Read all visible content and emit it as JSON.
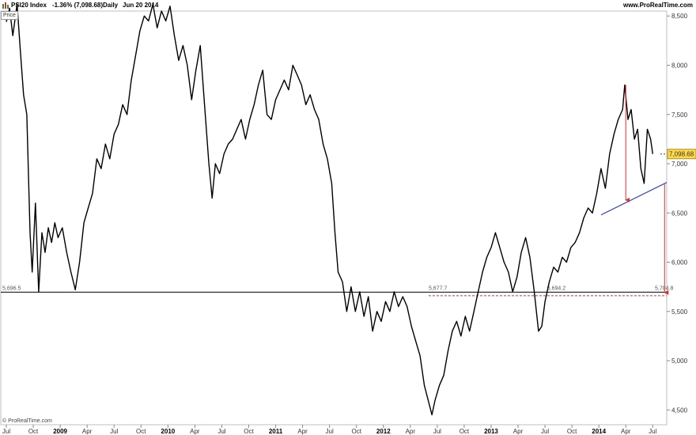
{
  "header": {
    "symbol": "PSI20 Index",
    "change": "-1.36% (7,098.68)",
    "interval": "Daily",
    "date": "Jun 20 2014",
    "site": "www.ProRealTime.com"
  },
  "price_tag": "Price",
  "copyright": "© ProRealTime.com",
  "colors": {
    "trendline": "#3344cc",
    "arrow": "#e03030",
    "price_label_bg": "#ffd84a",
    "support_dash": "#cc3333"
  },
  "chart_data": {
    "type": "line",
    "title": "",
    "xlabel": "",
    "ylabel": "",
    "ylim": [
      4350,
      8550
    ],
    "xlim": [
      2008.5,
      2014.63
    ],
    "yticks": [
      4500,
      5000,
      5500,
      6000,
      6500,
      7000,
      7500,
      8000,
      8500
    ],
    "ytick_labels": [
      "4,500",
      "5,000",
      "5,500",
      "6,000",
      "6,500",
      "7,000",
      "7,500",
      "8,000",
      "8,500"
    ],
    "xticks": [
      {
        "x": 2008.5,
        "label": "Jul",
        "bold": false
      },
      {
        "x": 2008.75,
        "label": "Oct",
        "bold": false
      },
      {
        "x": 2009.0,
        "label": "2009",
        "bold": true
      },
      {
        "x": 2009.25,
        "label": "Apr",
        "bold": false
      },
      {
        "x": 2009.5,
        "label": "Jul",
        "bold": false
      },
      {
        "x": 2009.75,
        "label": "Oct",
        "bold": false
      },
      {
        "x": 2010.0,
        "label": "2010",
        "bold": true
      },
      {
        "x": 2010.25,
        "label": "Apr",
        "bold": false
      },
      {
        "x": 2010.5,
        "label": "Jul",
        "bold": false
      },
      {
        "x": 2010.75,
        "label": "Oct",
        "bold": false
      },
      {
        "x": 2011.0,
        "label": "2011",
        "bold": true
      },
      {
        "x": 2011.25,
        "label": "Apr",
        "bold": false
      },
      {
        "x": 2011.5,
        "label": "Jul",
        "bold": false
      },
      {
        "x": 2011.75,
        "label": "Oct",
        "bold": false
      },
      {
        "x": 2012.0,
        "label": "2012",
        "bold": true
      },
      {
        "x": 2012.25,
        "label": "Apr",
        "bold": false
      },
      {
        "x": 2012.5,
        "label": "Jul",
        "bold": false
      },
      {
        "x": 2012.75,
        "label": "Oct",
        "bold": false
      },
      {
        "x": 2013.0,
        "label": "2013",
        "bold": true
      },
      {
        "x": 2013.25,
        "label": "Apr",
        "bold": false
      },
      {
        "x": 2013.5,
        "label": "Jul",
        "bold": false
      },
      {
        "x": 2013.75,
        "label": "Oct",
        "bold": false
      },
      {
        "x": 2014.0,
        "label": "2014",
        "bold": true
      },
      {
        "x": 2014.25,
        "label": "Apr",
        "bold": false
      },
      {
        "x": 2014.5,
        "label": "Jul",
        "bold": false
      }
    ],
    "series": [
      {
        "values": [
          [
            2008.5,
            8440
          ],
          [
            2008.53,
            8580
          ],
          [
            2008.56,
            8300
          ],
          [
            2008.6,
            8620
          ],
          [
            2008.63,
            8150
          ],
          [
            2008.66,
            7700
          ],
          [
            2008.69,
            7500
          ],
          [
            2008.72,
            6300
          ],
          [
            2008.74,
            5900
          ],
          [
            2008.77,
            6600
          ],
          [
            2008.8,
            5700
          ],
          [
            2008.83,
            6300
          ],
          [
            2008.86,
            6100
          ],
          [
            2008.89,
            6350
          ],
          [
            2008.92,
            6200
          ],
          [
            2008.95,
            6400
          ],
          [
            2008.98,
            6250
          ],
          [
            2009.02,
            6350
          ],
          [
            2009.06,
            6100
          ],
          [
            2009.1,
            5900
          ],
          [
            2009.14,
            5720
          ],
          [
            2009.18,
            6000
          ],
          [
            2009.22,
            6400
          ],
          [
            2009.26,
            6550
          ],
          [
            2009.3,
            6700
          ],
          [
            2009.34,
            7050
          ],
          [
            2009.38,
            6950
          ],
          [
            2009.42,
            7200
          ],
          [
            2009.46,
            7050
          ],
          [
            2009.5,
            7300
          ],
          [
            2009.54,
            7400
          ],
          [
            2009.58,
            7600
          ],
          [
            2009.62,
            7500
          ],
          [
            2009.66,
            7850
          ],
          [
            2009.7,
            8100
          ],
          [
            2009.74,
            8350
          ],
          [
            2009.78,
            8500
          ],
          [
            2009.82,
            8450
          ],
          [
            2009.86,
            8620
          ],
          [
            2009.9,
            8380
          ],
          [
            2009.94,
            8550
          ],
          [
            2009.98,
            8450
          ],
          [
            2010.02,
            8600
          ],
          [
            2010.06,
            8300
          ],
          [
            2010.1,
            8050
          ],
          [
            2010.14,
            8200
          ],
          [
            2010.18,
            8000
          ],
          [
            2010.22,
            7650
          ],
          [
            2010.26,
            7950
          ],
          [
            2010.3,
            8200
          ],
          [
            2010.34,
            7600
          ],
          [
            2010.38,
            7000
          ],
          [
            2010.41,
            6650
          ],
          [
            2010.44,
            7000
          ],
          [
            2010.48,
            6900
          ],
          [
            2010.52,
            7100
          ],
          [
            2010.56,
            7200
          ],
          [
            2010.6,
            7250
          ],
          [
            2010.64,
            7350
          ],
          [
            2010.68,
            7450
          ],
          [
            2010.72,
            7250
          ],
          [
            2010.76,
            7450
          ],
          [
            2010.8,
            7600
          ],
          [
            2010.84,
            7800
          ],
          [
            2010.88,
            7950
          ],
          [
            2010.92,
            7500
          ],
          [
            2010.96,
            7450
          ],
          [
            2011.0,
            7650
          ],
          [
            2011.04,
            7750
          ],
          [
            2011.08,
            7850
          ],
          [
            2011.12,
            7750
          ],
          [
            2011.16,
            8000
          ],
          [
            2011.2,
            7900
          ],
          [
            2011.24,
            7800
          ],
          [
            2011.28,
            7600
          ],
          [
            2011.32,
            7700
          ],
          [
            2011.36,
            7550
          ],
          [
            2011.4,
            7450
          ],
          [
            2011.44,
            7200
          ],
          [
            2011.48,
            7050
          ],
          [
            2011.52,
            6800
          ],
          [
            2011.55,
            6300
          ],
          [
            2011.58,
            5900
          ],
          [
            2011.62,
            5800
          ],
          [
            2011.66,
            5500
          ],
          [
            2011.7,
            5750
          ],
          [
            2011.74,
            5500
          ],
          [
            2011.78,
            5700
          ],
          [
            2011.82,
            5450
          ],
          [
            2011.86,
            5650
          ],
          [
            2011.9,
            5300
          ],
          [
            2011.94,
            5500
          ],
          [
            2011.98,
            5400
          ],
          [
            2012.02,
            5600
          ],
          [
            2012.06,
            5500
          ],
          [
            2012.1,
            5700
          ],
          [
            2012.14,
            5550
          ],
          [
            2012.18,
            5650
          ],
          [
            2012.22,
            5550
          ],
          [
            2012.26,
            5350
          ],
          [
            2012.3,
            5200
          ],
          [
            2012.34,
            5050
          ],
          [
            2012.38,
            4750
          ],
          [
            2012.42,
            4580
          ],
          [
            2012.45,
            4450
          ],
          [
            2012.48,
            4600
          ],
          [
            2012.52,
            4750
          ],
          [
            2012.56,
            4850
          ],
          [
            2012.6,
            5100
          ],
          [
            2012.64,
            5300
          ],
          [
            2012.68,
            5400
          ],
          [
            2012.72,
            5250
          ],
          [
            2012.76,
            5450
          ],
          [
            2012.8,
            5300
          ],
          [
            2012.84,
            5500
          ],
          [
            2012.88,
            5700
          ],
          [
            2012.92,
            5900
          ],
          [
            2012.96,
            6050
          ],
          [
            2013.0,
            6150
          ],
          [
            2013.04,
            6300
          ],
          [
            2013.08,
            6150
          ],
          [
            2013.12,
            6000
          ],
          [
            2013.16,
            5900
          ],
          [
            2013.2,
            5700
          ],
          [
            2013.24,
            5850
          ],
          [
            2013.28,
            6100
          ],
          [
            2013.32,
            6250
          ],
          [
            2013.36,
            6050
          ],
          [
            2013.4,
            5700
          ],
          [
            2013.44,
            5300
          ],
          [
            2013.47,
            5350
          ],
          [
            2013.5,
            5600
          ],
          [
            2013.54,
            5800
          ],
          [
            2013.58,
            5950
          ],
          [
            2013.62,
            5900
          ],
          [
            2013.66,
            6050
          ],
          [
            2013.7,
            6000
          ],
          [
            2013.74,
            6150
          ],
          [
            2013.78,
            6200
          ],
          [
            2013.82,
            6300
          ],
          [
            2013.86,
            6450
          ],
          [
            2013.9,
            6550
          ],
          [
            2013.94,
            6500
          ],
          [
            2013.98,
            6700
          ],
          [
            2014.02,
            6950
          ],
          [
            2014.06,
            6750
          ],
          [
            2014.1,
            7100
          ],
          [
            2014.14,
            7300
          ],
          [
            2014.18,
            7450
          ],
          [
            2014.22,
            7550
          ],
          [
            2014.24,
            7800
          ],
          [
            2014.27,
            7450
          ],
          [
            2014.3,
            7550
          ],
          [
            2014.33,
            7250
          ],
          [
            2014.36,
            7350
          ],
          [
            2014.39,
            6950
          ],
          [
            2014.42,
            6800
          ],
          [
            2014.45,
            7350
          ],
          [
            2014.48,
            7250
          ],
          [
            2014.5,
            7099
          ]
        ]
      }
    ],
    "support": {
      "value": 5696.5,
      "label": "5,696.5"
    },
    "support_zone_labels": [
      {
        "x": 2012.42,
        "label": "5,677.7"
      },
      {
        "x": 2013.52,
        "label": "5,694.2"
      },
      {
        "x": 2014.52,
        "label": "5,704.8"
      }
    ],
    "trendline": {
      "x": [
        2014.02,
        2014.63
      ],
      "y": [
        6480,
        6810
      ]
    },
    "arrows": [
      {
        "x": 2014.25,
        "y_from": 7800,
        "y_to": 6600
      },
      {
        "x": 2014.61,
        "y_from": 6800,
        "y_to": 5660
      }
    ],
    "last_price": {
      "value": 7098.68,
      "label": "7,098.68"
    }
  }
}
